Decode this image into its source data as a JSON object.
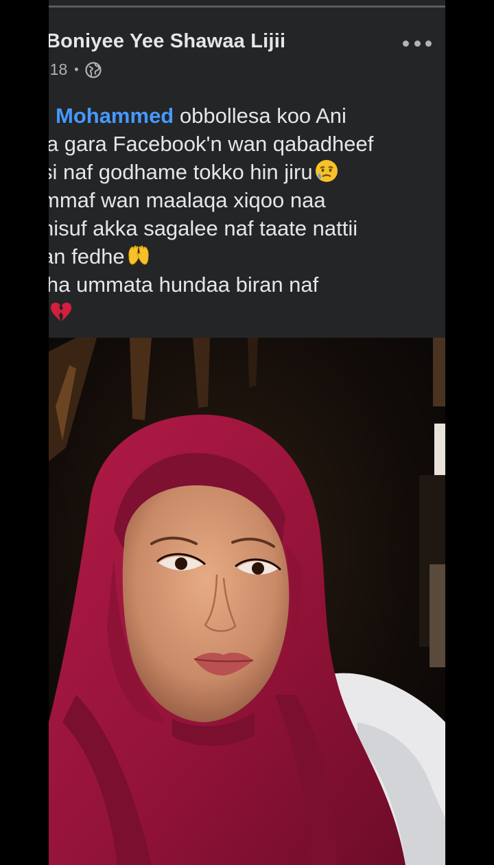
{
  "post": {
    "author": "Boniyee Yee Shawaa Lijii",
    "date": "18",
    "date_prefix": ")",
    "separator": "•",
    "privacy_icon": "globe-icon",
    "more_icon": "more-dots-icon",
    "text": {
      "mention": "Mohammed",
      "line1_rest": " obbollesa koo Ani",
      "line2": "la gara Facebook'n wan qabadheef",
      "line3": "si naf godhame tokko hin jiru",
      "line3_emoji": "sad-tear-emoji",
      "line4": "mmaf wan maalaqa xiqoo naa",
      "line5": "hisuf akka sagalee naf taate nattii",
      "line6": "an fedhe",
      "line6_emoji": "open-hands-emoji",
      "line7": "lha ummata hundaa biran naf",
      "line8_emoji": "broken-heart-emoji"
    },
    "photo": {
      "subject": "woman-in-magenta-hijab-selfie"
    }
  },
  "colors": {
    "background": "#242526",
    "outer": "#000000",
    "primary_text": "#e4e6eb",
    "secondary_text": "#b0b3b8",
    "mention": "#4599ff",
    "hijab": "#a3163f"
  }
}
